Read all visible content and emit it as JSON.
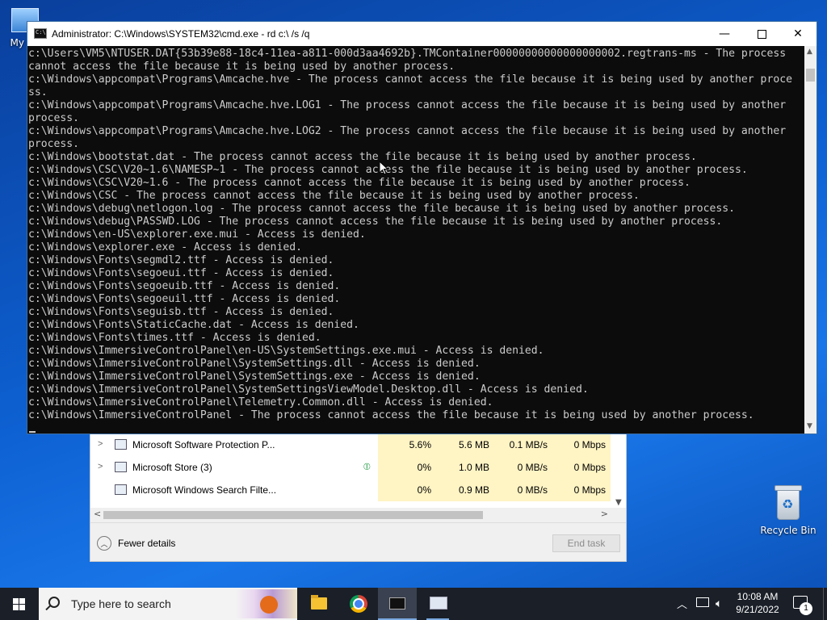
{
  "desktop": {
    "my_computer_label": "My Co",
    "recycle_bin_label": "Recycle Bin"
  },
  "task_manager": {
    "rows": [
      {
        "name": "Microsoft Software Protection P...",
        "cpu": "5.6%",
        "memory": "5.6 MB",
        "disk": "0.1 MB/s",
        "network": "0 Mbps",
        "expandable": true,
        "icon": "service-icon"
      },
      {
        "name": "Microsoft Store (3)",
        "cpu": "0%",
        "memory": "1.0 MB",
        "disk": "0 MB/s",
        "network": "0 Mbps",
        "expandable": true,
        "icon": "store-icon",
        "suspended_leaf": true
      },
      {
        "name": "Microsoft Windows Search Filte...",
        "cpu": "0%",
        "memory": "0.9 MB",
        "disk": "0 MB/s",
        "network": "0 Mbps",
        "expandable": false,
        "icon": "search-filter-icon"
      }
    ],
    "fewer_details": "Fewer details",
    "end_task": "End task"
  },
  "cmd": {
    "title": "Administrator: C:\\Windows\\SYSTEM32\\cmd.exe - rd  c:\\ /s /q",
    "lines": [
      "c:\\Users\\VM5\\NTUSER.DAT{53b39e88-18c4-11ea-a811-000d3aa4692b}.TMContainer00000000000000000002.regtrans-ms - The process",
      "cannot access the file because it is being used by another process.",
      "c:\\Windows\\appcompat\\Programs\\Amcache.hve - The process cannot access the file because it is being used by another proce",
      "ss.",
      "c:\\Windows\\appcompat\\Programs\\Amcache.hve.LOG1 - The process cannot access the file because it is being used by another",
      "process.",
      "c:\\Windows\\appcompat\\Programs\\Amcache.hve.LOG2 - The process cannot access the file because it is being used by another",
      "process.",
      "c:\\Windows\\bootstat.dat - The process cannot access the file because it is being used by another process.",
      "c:\\Windows\\CSC\\V20~1.6\\NAMESP~1 - The process cannot access the file because it is being used by another process.",
      "c:\\Windows\\CSC\\V20~1.6 - The process cannot access the file because it is being used by another process.",
      "c:\\Windows\\CSC - The process cannot access the file because it is being used by another process.",
      "c:\\Windows\\debug\\netlogon.log - The process cannot access the file because it is being used by another process.",
      "c:\\Windows\\debug\\PASSWD.LOG - The process cannot access the file because it is being used by another process.",
      "c:\\Windows\\en-US\\explorer.exe.mui - Access is denied.",
      "c:\\Windows\\explorer.exe - Access is denied.",
      "c:\\Windows\\Fonts\\segmdl2.ttf - Access is denied.",
      "c:\\Windows\\Fonts\\segoeui.ttf - Access is denied.",
      "c:\\Windows\\Fonts\\segoeuib.ttf - Access is denied.",
      "c:\\Windows\\Fonts\\segoeuil.ttf - Access is denied.",
      "c:\\Windows\\Fonts\\seguisb.ttf - Access is denied.",
      "c:\\Windows\\Fonts\\StaticCache.dat - Access is denied.",
      "c:\\Windows\\Fonts\\times.ttf - Access is denied.",
      "c:\\Windows\\ImmersiveControlPanel\\en-US\\SystemSettings.exe.mui - Access is denied.",
      "c:\\Windows\\ImmersiveControlPanel\\SystemSettings.dll - Access is denied.",
      "c:\\Windows\\ImmersiveControlPanel\\SystemSettings.exe - Access is denied.",
      "c:\\Windows\\ImmersiveControlPanel\\SystemSettingsViewModel.Desktop.dll - Access is denied.",
      "c:\\Windows\\ImmersiveControlPanel\\Telemetry.Common.dll - Access is denied.",
      "c:\\Windows\\ImmersiveControlPanel - The process cannot access the file because it is being used by another process."
    ],
    "colors": {
      "background": "#0c0c0c",
      "text": "#cccccc"
    }
  },
  "taskbar": {
    "search_placeholder": "Type here to search",
    "time": "10:08 AM",
    "date": "9/21/2022",
    "notification_count": "1",
    "apps": [
      "file-explorer-icon",
      "chrome-icon",
      "cmd-icon",
      "task-manager-icon"
    ]
  }
}
